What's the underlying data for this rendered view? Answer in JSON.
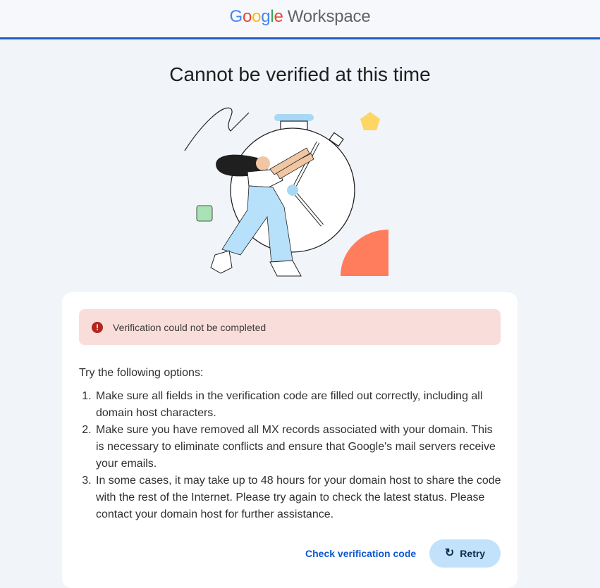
{
  "header": {
    "logo_letters": [
      "G",
      "o",
      "o",
      "g",
      "l",
      "e"
    ],
    "product": "Workspace"
  },
  "main": {
    "title": "Cannot be verified at this time"
  },
  "alert": {
    "icon": "error-icon",
    "text": "Verification could not be completed"
  },
  "options": {
    "heading": "Try the following options:",
    "items": [
      "Make sure all fields in the verification code are filled out correctly, including all domain host characters.",
      "Make sure you have removed all MX records associated with your domain. This is necessary to eliminate conflicts and ensure that Google's mail servers receive your emails.",
      "In some cases, it may take up to 48 hours for your domain host to share the code with the rest of the Internet. Please try again to check the latest status. Please contact your domain host for further assistance."
    ]
  },
  "actions": {
    "check_label": "Check verification code",
    "retry_label": "Retry",
    "retry_icon": "refresh-icon"
  },
  "colors": {
    "accent": "#1a5fc4",
    "link": "#0b57d0",
    "alert_bg": "#f9ddda",
    "error": "#b3261e",
    "button_bg": "#c2e1fb"
  }
}
